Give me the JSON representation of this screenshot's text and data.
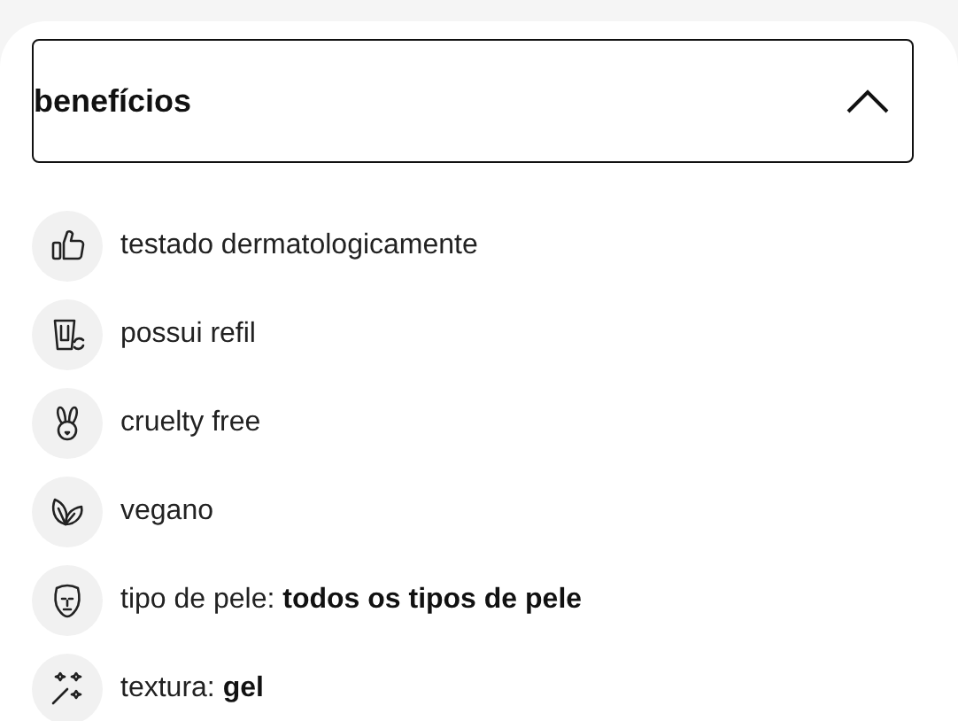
{
  "accordion": {
    "title": "benefícios",
    "expanded": true,
    "items": [
      {
        "text": "testado dermatologicamente"
      },
      {
        "text": "possui refil"
      },
      {
        "text": "cruelty free"
      },
      {
        "text": "vegano"
      },
      {
        "text": "tipo de pele: **todos os tipos de pele**"
      },
      {
        "text": "textura: **gel**"
      }
    ]
  }
}
